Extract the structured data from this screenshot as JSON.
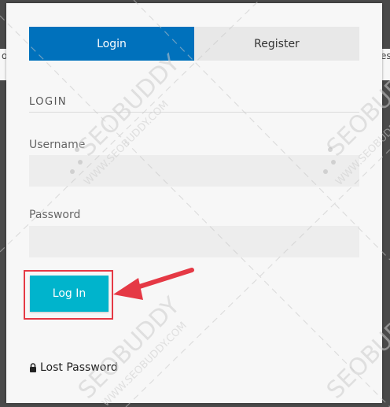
{
  "edges": {
    "left_text": "o",
    "right_text": "es"
  },
  "tabs": [
    {
      "label": "Login",
      "active": true
    },
    {
      "label": "Register",
      "active": false
    }
  ],
  "form": {
    "section_title": "LOGIN",
    "username_label": "Username",
    "username_value": "",
    "password_label": "Password",
    "password_value": "",
    "submit_label": "Log In"
  },
  "lost_password": {
    "label": "Lost Password"
  },
  "watermark": {
    "brand": "SEOBUDDY",
    "url": "WWW.SEOBUDDY.COM"
  },
  "colors": {
    "active_tab": "#0071bc",
    "submit_button": "#00b4cc",
    "highlight": "#e53945"
  }
}
